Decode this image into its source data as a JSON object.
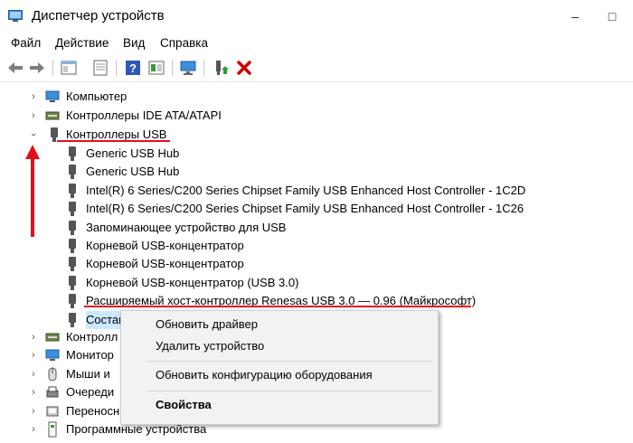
{
  "window": {
    "title": "Диспетчер устройств",
    "minimize": "–",
    "maximize": "□"
  },
  "menu": [
    "Файл",
    "Действие",
    "Вид",
    "Справка"
  ],
  "toolbar": [
    "back-icon",
    "forward-icon",
    "properties-icon",
    "update-icon",
    "help-icon",
    "show-hidden-icon",
    "monitor-icon",
    "enable-device-icon",
    "delete-icon"
  ],
  "tree": {
    "top": [
      {
        "label": "Компьютер"
      },
      {
        "label": "Контроллеры IDE ATA/ATAPI"
      },
      {
        "label": "Контроллеры USB"
      }
    ],
    "usb_children": [
      "Generic USB Hub",
      "Generic USB Hub",
      "Intel(R) 6 Series/C200 Series Chipset Family USB Enhanced Host Controller - 1C2D",
      "Intel(R) 6 Series/C200 Series Chipset Family USB Enhanced Host Controller - 1C26",
      "Запоминающее устройство для USB",
      "Корневой USB-концентратор",
      "Корневой USB-концентратор",
      "Корневой USB-концентратор (USB 3.0)",
      "Расширяемый хост-контроллер Renesas USB 3.0 — 0.96 (Майкрософт)",
      "Состав"
    ],
    "bottom": [
      "Контролл",
      "Монитор",
      "Мыши и ",
      "Очереди",
      "Переносн",
      "Программные устройства"
    ]
  },
  "context_menu": {
    "update_driver": "Обновить драйвер",
    "uninstall": "Удалить устройство",
    "scan": "Обновить конфигурацию оборудования",
    "properties": "Свойства"
  },
  "colors": {
    "annotation": "#e3101b",
    "selection": "#cce8ff"
  }
}
